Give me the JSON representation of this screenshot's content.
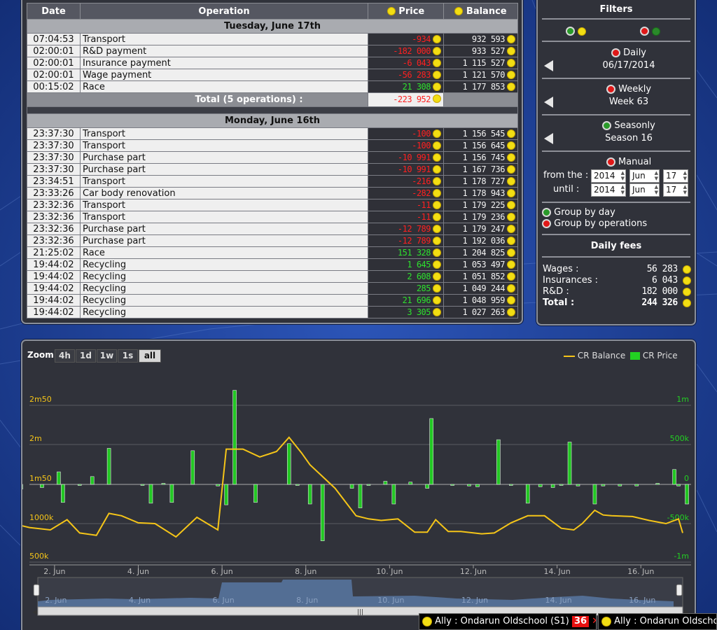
{
  "ops": {
    "headers": {
      "date": "Date",
      "operation": "Operation",
      "price": "Price",
      "balance": "Balance"
    },
    "day1": {
      "label": "Tuesday, June 17th",
      "rows": [
        {
          "t": "07:04:53",
          "op": "Transport",
          "p": "-934",
          "pc": "red",
          "b": "932 593"
        },
        {
          "t": "02:00:01",
          "op": "R&D payment",
          "p": "-182 000",
          "pc": "red",
          "b": "933 527"
        },
        {
          "t": "02:00:01",
          "op": "Insurance payment",
          "p": "-6 043",
          "pc": "red",
          "b": "1 115 527"
        },
        {
          "t": "02:00:01",
          "op": "Wage payment",
          "p": "-56 283",
          "pc": "red",
          "b": "1 121 570"
        },
        {
          "t": "00:15:02",
          "op": "Race",
          "p": "21 308",
          "pc": "green",
          "b": "1 177 853"
        }
      ],
      "total_label": "Total (5 operations) :",
      "total_value": "-223 952"
    },
    "day2": {
      "label": "Monday, June 16th",
      "rows": [
        {
          "t": "23:37:30",
          "op": "Transport",
          "p": "-100",
          "pc": "red",
          "b": "1 156 545"
        },
        {
          "t": "23:37:30",
          "op": "Transport",
          "p": "-100",
          "pc": "red",
          "b": "1 156 645"
        },
        {
          "t": "23:37:30",
          "op": "Purchase part",
          "p": "-10 991",
          "pc": "red",
          "b": "1 156 745"
        },
        {
          "t": "23:37:30",
          "op": "Purchase part",
          "p": "-10 991",
          "pc": "red",
          "b": "1 167 736"
        },
        {
          "t": "23:34:51",
          "op": "Transport",
          "p": "-216",
          "pc": "red",
          "b": "1 178 727"
        },
        {
          "t": "23:33:26",
          "op": "Car body renovation",
          "p": "-282",
          "pc": "red",
          "b": "1 178 943"
        },
        {
          "t": "23:32:36",
          "op": "Transport",
          "p": "-11",
          "pc": "red",
          "b": "1 179 225"
        },
        {
          "t": "23:32:36",
          "op": "Transport",
          "p": "-11",
          "pc": "red",
          "b": "1 179 236"
        },
        {
          "t": "23:32:36",
          "op": "Purchase part",
          "p": "-12 789",
          "pc": "red",
          "b": "1 179 247"
        },
        {
          "t": "23:32:36",
          "op": "Purchase part",
          "p": "-12 789",
          "pc": "red",
          "b": "1 192 036"
        },
        {
          "t": "21:25:02",
          "op": "Race",
          "p": "151 328",
          "pc": "green",
          "b": "1 204 825"
        },
        {
          "t": "19:44:02",
          "op": "Recycling",
          "p": "1 645",
          "pc": "green",
          "b": "1 053 497"
        },
        {
          "t": "19:44:02",
          "op": "Recycling",
          "p": "2 608",
          "pc": "green",
          "b": "1 051 852"
        },
        {
          "t": "19:44:02",
          "op": "Recycling",
          "p": "285",
          "pc": "green",
          "b": "1 049 244"
        },
        {
          "t": "19:44:02",
          "op": "Recycling",
          "p": "21 696",
          "pc": "green",
          "b": "1 048 959"
        },
        {
          "t": "19:44:02",
          "op": "Recycling",
          "p": "3 305",
          "pc": "green",
          "b": "1 027 263"
        }
      ]
    }
  },
  "filters": {
    "title": "Filters",
    "daily": "Daily",
    "daily_value": "06/17/2014",
    "weekly": "Weekly",
    "weekly_value": "Week 63",
    "seasonly": "Seasonly",
    "seasonly_value": "Season 16",
    "manual": "Manual",
    "from_label": "from the :",
    "until_label": "until :",
    "from": {
      "year": "2014",
      "month": "Jun",
      "day": "17"
    },
    "until": {
      "year": "2014",
      "month": "Jun",
      "day": "17"
    },
    "group_day": "Group by day",
    "group_ops": "Group by operations",
    "fees_title": "Daily fees",
    "fees": [
      {
        "label": "Wages :",
        "value": "56 283"
      },
      {
        "label": "Insurances :",
        "value": "6 043"
      },
      {
        "label": "R&D :",
        "value": "182 000"
      },
      {
        "label": "Total :",
        "value": "244 326"
      }
    ]
  },
  "chart": {
    "zoom_label": "Zoom",
    "zoom_buttons": [
      "4h",
      "1d",
      "1w",
      "1s",
      "all"
    ],
    "zoom_selected": "all",
    "legend_balance": "CR Balance",
    "legend_price": "CR Price",
    "left_ticks": [
      "2m50",
      "2m",
      "1m50",
      "1000k",
      "500k"
    ],
    "right_ticks": [
      "1m",
      "500k",
      "0",
      "-500k",
      "-1m"
    ],
    "x_ticks": [
      "2. Jun",
      "4. Jun",
      "6. Jun",
      "8. Jun",
      "10. Jun",
      "12. Jun",
      "14. Jun",
      "16. Jun"
    ],
    "nav_ticks": [
      "2. Jun",
      "4. Jun",
      "6. Jun",
      "8. Jun",
      "10. Jun",
      "12. Jun",
      "14. Jun",
      "16. Jun"
    ],
    "colors": {
      "balance": "#f5c518",
      "price": "#22d022",
      "grid": "#5a5c63"
    }
  },
  "chart_data": {
    "type": "line",
    "title": "",
    "series": [
      {
        "name": "CR Balance",
        "axis": "left",
        "x": [
          1.0,
          1.4,
          1.9,
          2.3,
          2.6,
          3.0,
          3.3,
          3.6,
          4.0,
          4.4,
          4.9,
          5.4,
          5.9,
          6.1,
          6.5,
          6.9,
          7.3,
          7.6,
          7.9,
          8.1,
          8.7,
          9.2,
          9.5,
          9.8,
          10.2,
          10.6,
          10.9,
          11.1,
          11.4,
          11.7,
          12.2,
          12.5,
          12.9,
          13.3,
          13.7,
          14.1,
          14.4,
          14.6,
          14.9,
          15.1,
          15.3,
          15.8,
          16.2,
          16.6,
          16.9,
          17.0
        ],
        "y": [
          1000000,
          950000,
          920000,
          1050000,
          880000,
          850000,
          1130000,
          1100000,
          1010000,
          1000000,
          830000,
          1080000,
          920000,
          1950000,
          1950000,
          1850000,
          1920000,
          2100000,
          1900000,
          1750000,
          1450000,
          1100000,
          1060000,
          1040000,
          1060000,
          890000,
          890000,
          1050000,
          900000,
          900000,
          870000,
          880000,
          1010000,
          1100000,
          1100000,
          940000,
          920000,
          1000000,
          1170000,
          1110000,
          1100000,
          1090000,
          1040000,
          1000000,
          1060000,
          880000
        ]
      },
      {
        "name": "CR Price",
        "axis": "right",
        "type": "bar",
        "x": [
          1.2,
          1.7,
          2.1,
          2.2,
          2.6,
          2.9,
          3.3,
          4.1,
          4.3,
          4.6,
          4.8,
          5.3,
          5.9,
          6.1,
          6.3,
          6.8,
          7.6,
          7.8,
          8.1,
          8.4,
          9.1,
          9.3,
          9.5,
          9.9,
          10.1,
          10.5,
          10.9,
          11.0,
          11.5,
          11.9,
          12.1,
          12.6,
          12.9,
          13.3,
          13.6,
          13.9,
          14.1,
          14.3,
          14.5,
          14.9,
          15.1,
          15.5,
          15.9,
          16.4,
          16.8,
          16.9,
          17.1
        ],
        "y": [
          -60000,
          -40000,
          160000,
          -230000,
          -10000,
          100000,
          460000,
          -10000,
          -240000,
          10000,
          -230000,
          430000,
          -20000,
          -260000,
          1200000,
          -230000,
          520000,
          -10000,
          -250000,
          -720000,
          -50000,
          -300000,
          -10000,
          40000,
          -250000,
          30000,
          -50000,
          840000,
          -10000,
          -20000,
          -30000,
          570000,
          -10000,
          -240000,
          -30000,
          -40000,
          -10000,
          540000,
          -20000,
          -250000,
          -20000,
          -20000,
          -20000,
          10000,
          190000,
          -20000,
          -250000
        ]
      }
    ],
    "x_unit": "June 2014 (day)",
    "xlim": [
      1.4,
      17.2
    ],
    "left_ylim": [
      450000,
      2700000
    ],
    "right_ylim": [
      -1000000,
      1000000
    ],
    "legend": "top-right",
    "grid": true
  }
}
